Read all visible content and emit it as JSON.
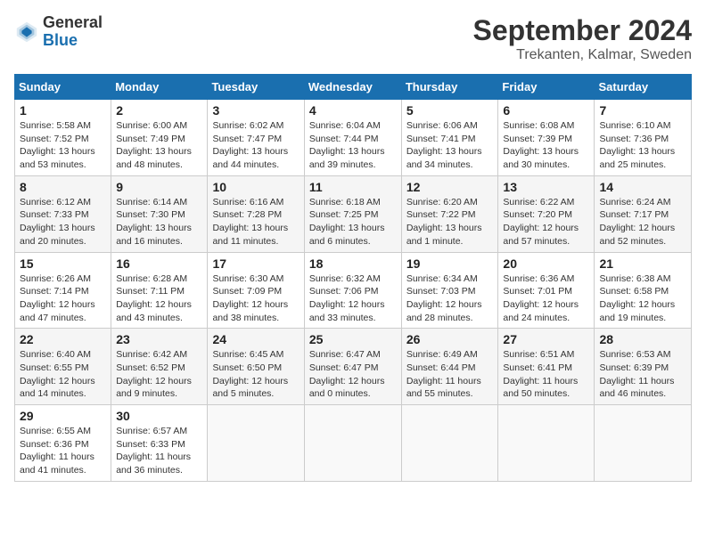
{
  "header": {
    "logo_general": "General",
    "logo_blue": "Blue",
    "month_year": "September 2024",
    "location": "Trekanten, Kalmar, Sweden"
  },
  "weekdays": [
    "Sunday",
    "Monday",
    "Tuesday",
    "Wednesday",
    "Thursday",
    "Friday",
    "Saturday"
  ],
  "weeks": [
    [
      {
        "day": "1",
        "sunrise": "Sunrise: 5:58 AM",
        "sunset": "Sunset: 7:52 PM",
        "daylight": "Daylight: 13 hours and 53 minutes."
      },
      {
        "day": "2",
        "sunrise": "Sunrise: 6:00 AM",
        "sunset": "Sunset: 7:49 PM",
        "daylight": "Daylight: 13 hours and 48 minutes."
      },
      {
        "day": "3",
        "sunrise": "Sunrise: 6:02 AM",
        "sunset": "Sunset: 7:47 PM",
        "daylight": "Daylight: 13 hours and 44 minutes."
      },
      {
        "day": "4",
        "sunrise": "Sunrise: 6:04 AM",
        "sunset": "Sunset: 7:44 PM",
        "daylight": "Daylight: 13 hours and 39 minutes."
      },
      {
        "day": "5",
        "sunrise": "Sunrise: 6:06 AM",
        "sunset": "Sunset: 7:41 PM",
        "daylight": "Daylight: 13 hours and 34 minutes."
      },
      {
        "day": "6",
        "sunrise": "Sunrise: 6:08 AM",
        "sunset": "Sunset: 7:39 PM",
        "daylight": "Daylight: 13 hours and 30 minutes."
      },
      {
        "day": "7",
        "sunrise": "Sunrise: 6:10 AM",
        "sunset": "Sunset: 7:36 PM",
        "daylight": "Daylight: 13 hours and 25 minutes."
      }
    ],
    [
      {
        "day": "8",
        "sunrise": "Sunrise: 6:12 AM",
        "sunset": "Sunset: 7:33 PM",
        "daylight": "Daylight: 13 hours and 20 minutes."
      },
      {
        "day": "9",
        "sunrise": "Sunrise: 6:14 AM",
        "sunset": "Sunset: 7:30 PM",
        "daylight": "Daylight: 13 hours and 16 minutes."
      },
      {
        "day": "10",
        "sunrise": "Sunrise: 6:16 AM",
        "sunset": "Sunset: 7:28 PM",
        "daylight": "Daylight: 13 hours and 11 minutes."
      },
      {
        "day": "11",
        "sunrise": "Sunrise: 6:18 AM",
        "sunset": "Sunset: 7:25 PM",
        "daylight": "Daylight: 13 hours and 6 minutes."
      },
      {
        "day": "12",
        "sunrise": "Sunrise: 6:20 AM",
        "sunset": "Sunset: 7:22 PM",
        "daylight": "Daylight: 13 hours and 1 minute."
      },
      {
        "day": "13",
        "sunrise": "Sunrise: 6:22 AM",
        "sunset": "Sunset: 7:20 PM",
        "daylight": "Daylight: 12 hours and 57 minutes."
      },
      {
        "day": "14",
        "sunrise": "Sunrise: 6:24 AM",
        "sunset": "Sunset: 7:17 PM",
        "daylight": "Daylight: 12 hours and 52 minutes."
      }
    ],
    [
      {
        "day": "15",
        "sunrise": "Sunrise: 6:26 AM",
        "sunset": "Sunset: 7:14 PM",
        "daylight": "Daylight: 12 hours and 47 minutes."
      },
      {
        "day": "16",
        "sunrise": "Sunrise: 6:28 AM",
        "sunset": "Sunset: 7:11 PM",
        "daylight": "Daylight: 12 hours and 43 minutes."
      },
      {
        "day": "17",
        "sunrise": "Sunrise: 6:30 AM",
        "sunset": "Sunset: 7:09 PM",
        "daylight": "Daylight: 12 hours and 38 minutes."
      },
      {
        "day": "18",
        "sunrise": "Sunrise: 6:32 AM",
        "sunset": "Sunset: 7:06 PM",
        "daylight": "Daylight: 12 hours and 33 minutes."
      },
      {
        "day": "19",
        "sunrise": "Sunrise: 6:34 AM",
        "sunset": "Sunset: 7:03 PM",
        "daylight": "Daylight: 12 hours and 28 minutes."
      },
      {
        "day": "20",
        "sunrise": "Sunrise: 6:36 AM",
        "sunset": "Sunset: 7:01 PM",
        "daylight": "Daylight: 12 hours and 24 minutes."
      },
      {
        "day": "21",
        "sunrise": "Sunrise: 6:38 AM",
        "sunset": "Sunset: 6:58 PM",
        "daylight": "Daylight: 12 hours and 19 minutes."
      }
    ],
    [
      {
        "day": "22",
        "sunrise": "Sunrise: 6:40 AM",
        "sunset": "Sunset: 6:55 PM",
        "daylight": "Daylight: 12 hours and 14 minutes."
      },
      {
        "day": "23",
        "sunrise": "Sunrise: 6:42 AM",
        "sunset": "Sunset: 6:52 PM",
        "daylight": "Daylight: 12 hours and 9 minutes."
      },
      {
        "day": "24",
        "sunrise": "Sunrise: 6:45 AM",
        "sunset": "Sunset: 6:50 PM",
        "daylight": "Daylight: 12 hours and 5 minutes."
      },
      {
        "day": "25",
        "sunrise": "Sunrise: 6:47 AM",
        "sunset": "Sunset: 6:47 PM",
        "daylight": "Daylight: 12 hours and 0 minutes."
      },
      {
        "day": "26",
        "sunrise": "Sunrise: 6:49 AM",
        "sunset": "Sunset: 6:44 PM",
        "daylight": "Daylight: 11 hours and 55 minutes."
      },
      {
        "day": "27",
        "sunrise": "Sunrise: 6:51 AM",
        "sunset": "Sunset: 6:41 PM",
        "daylight": "Daylight: 11 hours and 50 minutes."
      },
      {
        "day": "28",
        "sunrise": "Sunrise: 6:53 AM",
        "sunset": "Sunset: 6:39 PM",
        "daylight": "Daylight: 11 hours and 46 minutes."
      }
    ],
    [
      {
        "day": "29",
        "sunrise": "Sunrise: 6:55 AM",
        "sunset": "Sunset: 6:36 PM",
        "daylight": "Daylight: 11 hours and 41 minutes."
      },
      {
        "day": "30",
        "sunrise": "Sunrise: 6:57 AM",
        "sunset": "Sunset: 6:33 PM",
        "daylight": "Daylight: 11 hours and 36 minutes."
      },
      null,
      null,
      null,
      null,
      null
    ]
  ]
}
